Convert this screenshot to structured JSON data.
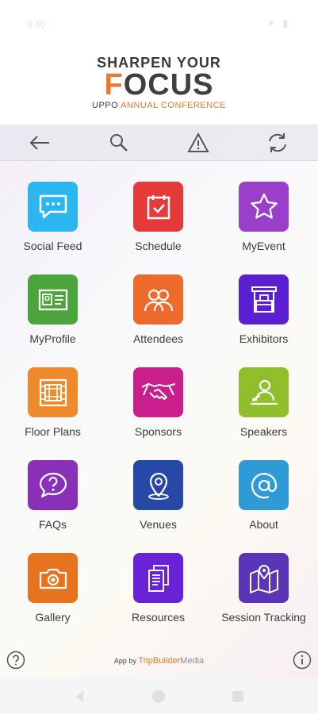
{
  "status_bar": {
    "time": "9:40",
    "icons": "▾ ▮"
  },
  "header": {
    "logo_line1": "SHARPEN YOUR",
    "logo_line2_accent": "F",
    "logo_line2_rest": "OCUS",
    "logo_line3_plain": "UPPO",
    "logo_line3_accent": "ANNUAL CONFERENCE"
  },
  "toolbar": {
    "buttons": [
      "back-icon",
      "search-icon",
      "warning-icon",
      "refresh-icon"
    ]
  },
  "tiles": [
    {
      "label": "Social Feed",
      "color": "#2bb6f1",
      "icon": "chat-icon"
    },
    {
      "label": "Schedule",
      "color": "#e53a3a",
      "icon": "calendar-check-icon"
    },
    {
      "label": "MyEvent",
      "color": "#9a3fc9",
      "icon": "star-icon"
    },
    {
      "label": "MyProfile",
      "color": "#4ca53b",
      "icon": "id-card-icon"
    },
    {
      "label": "Attendees",
      "color": "#ee6a2b",
      "icon": "people-icon"
    },
    {
      "label": "Exhibitors",
      "color": "#5a1fd1",
      "icon": "booth-icon"
    },
    {
      "label": "Floor Plans",
      "color": "#ee8a2b",
      "icon": "floor-plan-icon"
    },
    {
      "label": "Sponsors",
      "color": "#c81f8c",
      "icon": "handshake-icon"
    },
    {
      "label": "Speakers",
      "color": "#8fbf2a",
      "icon": "speaker-icon"
    },
    {
      "label": "FAQs",
      "color": "#8a2fb7",
      "icon": "question-bubble-icon"
    },
    {
      "label": "Venues",
      "color": "#2848a8",
      "icon": "location-pin-icon"
    },
    {
      "label": "About",
      "color": "#2e9ad6",
      "icon": "at-sign-icon"
    },
    {
      "label": "Gallery",
      "color": "#e8731f",
      "icon": "camera-icon"
    },
    {
      "label": "Resources",
      "color": "#6a22d6",
      "icon": "documents-icon"
    },
    {
      "label": "Session Tracking",
      "color": "#5a35b8",
      "icon": "map-pin-icon"
    }
  ],
  "footer": {
    "credit_prefix": "App by",
    "brand": "TripBuilder",
    "brand2": "Media"
  }
}
